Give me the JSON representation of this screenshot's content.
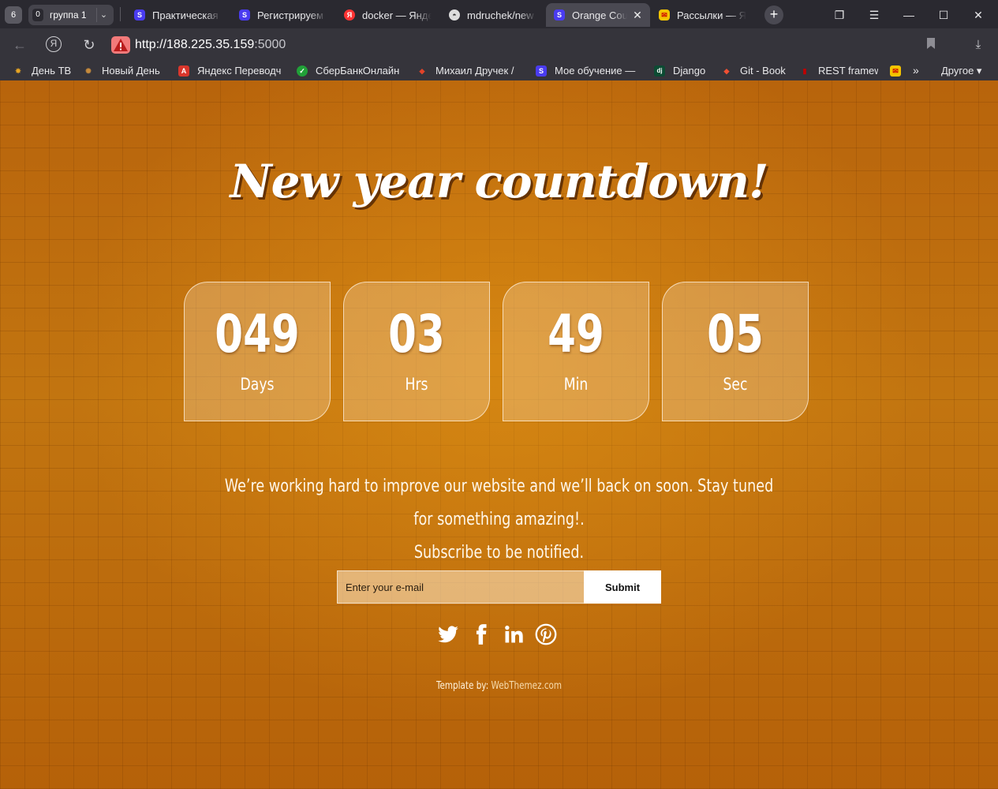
{
  "browser": {
    "tab_count": "6",
    "group": {
      "count": "0",
      "name": "группа 1"
    },
    "tabs": [
      {
        "title": "Практическая",
        "icon": "s-icon",
        "color": "#4a3cf0",
        "glyph": "S"
      },
      {
        "title": "Регистрируем",
        "icon": "s-icon",
        "color": "#4a3cf0",
        "glyph": "S"
      },
      {
        "title": "docker — Янде",
        "icon": "yandex-icon",
        "color": "#f33",
        "glyph": "Я"
      },
      {
        "title": "mdruchek/new",
        "icon": "github-icon",
        "color": "#555",
        "glyph": "◓"
      },
      {
        "title": "Orange Cou",
        "icon": "s-icon",
        "color": "#4a3cf0",
        "glyph": "S"
      },
      {
        "title": "Рассылки — Я",
        "icon": "mail-icon",
        "color": "#e8b000",
        "glyph": "✉"
      }
    ],
    "url": {
      "host": "http://188.225.35.159",
      "port": ":5000"
    },
    "bookmarks": [
      {
        "label": "День ТВ",
        "icon": "star-icon",
        "color": "#e7a524",
        "glyph": "✸"
      },
      {
        "label": "Новый День",
        "icon": "sun-icon",
        "color": "#b07a3a",
        "glyph": "✺"
      },
      {
        "label": "Яндекс Переводч",
        "icon": "translate-icon",
        "color": "#d9362c",
        "glyph": "A"
      },
      {
        "label": "СберБанкОнлайн",
        "icon": "sber-icon",
        "color": "#21a038",
        "glyph": "✓"
      },
      {
        "label": "Михаил Дручек /",
        "icon": "gitlab-icon",
        "color": "#e24329",
        "glyph": "◆"
      },
      {
        "label": "Мое обучение —",
        "icon": "s-icon",
        "color": "#4a3cf0",
        "glyph": "S"
      },
      {
        "label": "Django",
        "icon": "django-icon",
        "color": "#0c4b33",
        "glyph": "dj"
      },
      {
        "label": "Git - Book",
        "icon": "git-icon",
        "color": "#f05033",
        "glyph": "◆"
      },
      {
        "label": "REST framew",
        "icon": "rest-icon",
        "color": "#a30000",
        "glyph": "▮"
      }
    ],
    "other_label": "Другое"
  },
  "page": {
    "headline": "New year countdown!",
    "counters": [
      {
        "value": "049",
        "label": "Days"
      },
      {
        "value": "03",
        "label": "Hrs"
      },
      {
        "value": "49",
        "label": "Min"
      },
      {
        "value": "05",
        "label": "Sec"
      }
    ],
    "tagline_line1": "We’re working hard to improve our website and we’ll back on soon. Stay tuned for something amazing!.",
    "tagline_line2": "Subscribe to be notified.",
    "email_placeholder": "Enter your e-mail",
    "submit_label": "Submit",
    "socials": [
      "twitter-icon",
      "facebook-icon",
      "linkedin-icon",
      "pinterest-icon"
    ],
    "credit_prefix": "Template by:",
    "credit_link": "WebThemez.com"
  }
}
